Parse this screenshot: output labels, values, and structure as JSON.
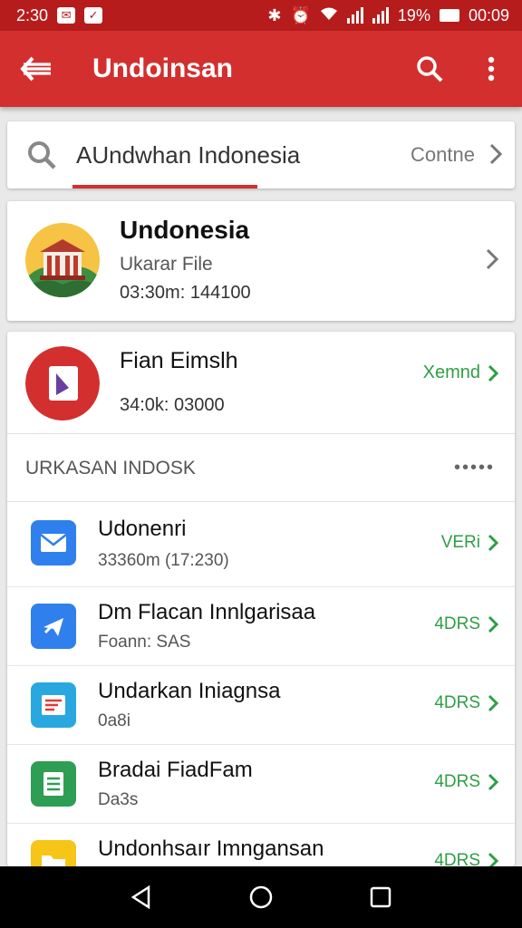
{
  "status_bar": {
    "time": "2:30",
    "battery": "19%",
    "clock_right": "00:09",
    "icons": [
      "notification-icon",
      "app-icon",
      "bluetooth-icon",
      "alarm-icon",
      "wifi-icon",
      "signal-icon",
      "battery-icon"
    ]
  },
  "app_bar": {
    "title": "Undoinsan",
    "icons": [
      "back-arrow-icon",
      "search-icon",
      "more-vert-icon"
    ]
  },
  "search": {
    "query": "AUndwhan Indonesia",
    "action": "Contne"
  },
  "card1": {
    "title": "Undonesia",
    "subtitle": "Ukarar File",
    "time": "03:30m: 144100"
  },
  "card2": {
    "title": "Fian Eimslh",
    "time": "34:0k: 03000",
    "action": "Xemnd",
    "section_header": "URKASAN INDOSK",
    "section_more": "•••••",
    "rows": [
      {
        "title": "Udonenri",
        "subtitle": "33360m (17:230)",
        "action": "VERi",
        "icon": "mail-icon",
        "color": "#2f80ed"
      },
      {
        "title": "Dm Flacan Innlgarisaa",
        "subtitle": "Foann: SAS",
        "action": "4DRS",
        "icon": "plane-icon",
        "color": "#2f80ed"
      },
      {
        "title": "Undarkan Iniagnsa",
        "subtitle": "0a8i",
        "action": "4DRS",
        "icon": "document-icon",
        "color": "#29a8e0"
      },
      {
        "title": "Bradai  FiadFam",
        "subtitle": "Da3s",
        "action": "4DRS",
        "icon": "list-icon",
        "color": "#2e9e55"
      },
      {
        "title": "Undonhsaır Imngansan",
        "subtitle": "",
        "action": "4DRS",
        "icon": "folder-icon",
        "color": "#f5c518"
      }
    ]
  },
  "colors": {
    "primary": "#d32f2f",
    "status": "#b71c1c",
    "action_green": "#2e9e45"
  }
}
